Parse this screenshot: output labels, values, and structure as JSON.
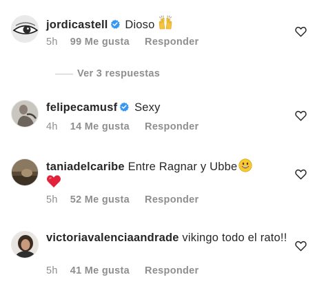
{
  "comments": [
    {
      "username": "jordicastell",
      "verified": true,
      "text": "Dioso",
      "emoji": "raising-hands",
      "time": "5h",
      "likes": "99 Me gusta",
      "reply": "Responder"
    },
    {
      "username": "felipecamusf",
      "verified": true,
      "text": "Sexy",
      "time": "4h",
      "likes": "14 Me gusta",
      "reply": "Responder"
    },
    {
      "username": "taniadelcaribe",
      "verified": false,
      "text": "Entre Ragnar y Ubbe",
      "emoji": "smiley-face",
      "emoji2": "red-heart",
      "time": "5h",
      "likes": "52 Me gusta",
      "reply": "Responder"
    },
    {
      "username": "victoriavalenciaandrade",
      "verified": false,
      "text": "vikingo todo el rato!!",
      "time": "5h",
      "likes": "41 Me gusta",
      "reply": "Responder"
    }
  ],
  "view_replies": "Ver 3 respuestas",
  "colors": {
    "text": "#262626",
    "meta": "#8e8e8e",
    "verified": "#3897f0",
    "heart_outline": "#262626"
  }
}
